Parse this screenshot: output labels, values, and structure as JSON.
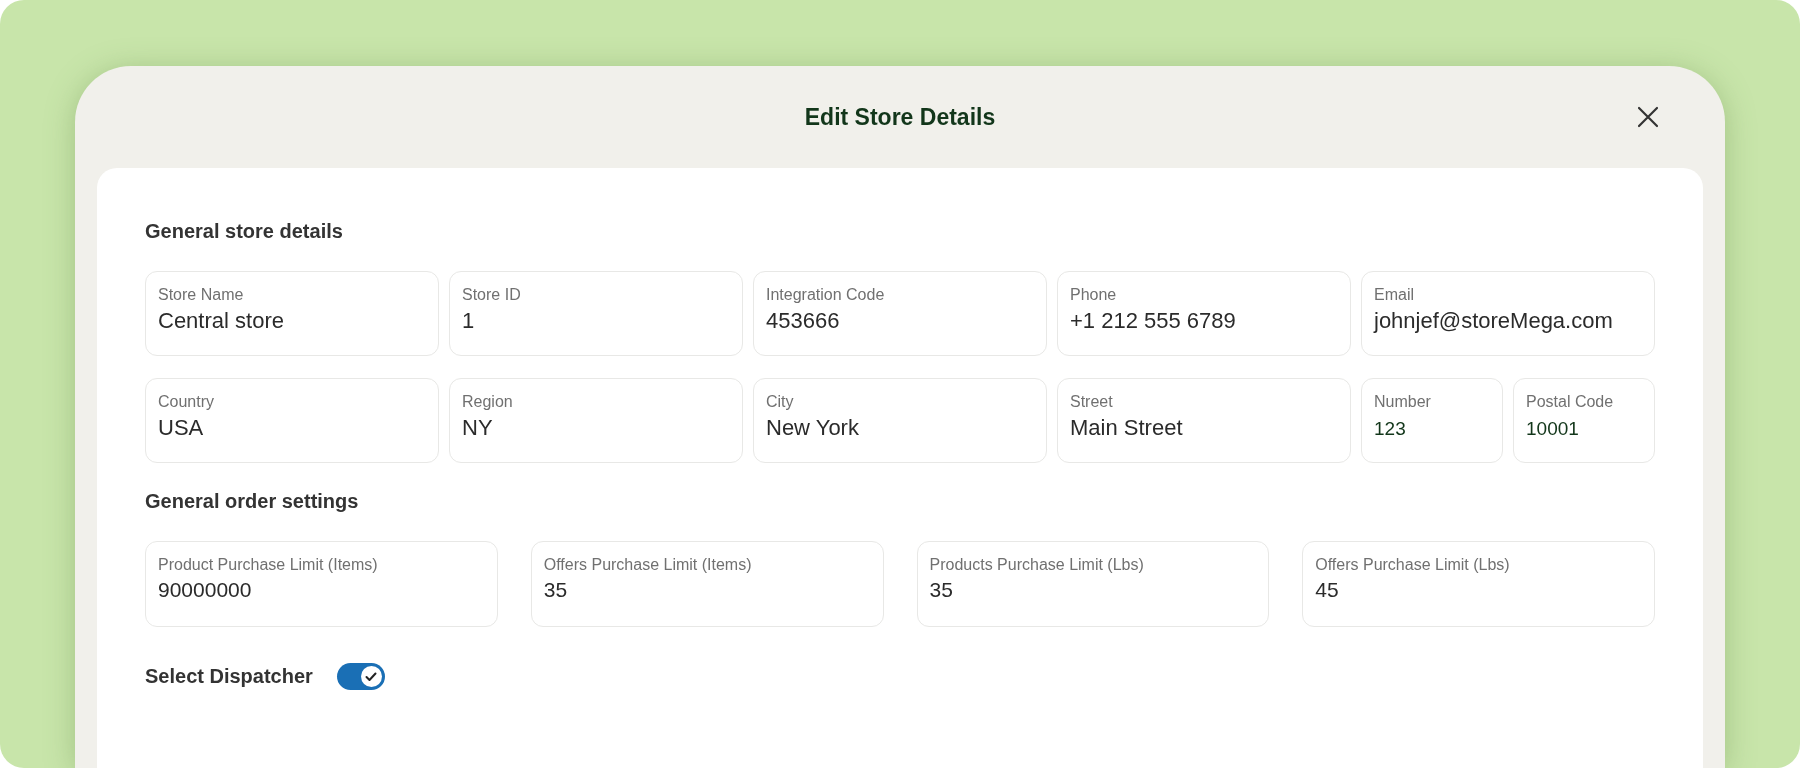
{
  "dialog": {
    "title": "Edit Store Details"
  },
  "sections": [
    {
      "heading": "General store details",
      "rows": [
        [
          {
            "label": "Store Name",
            "value": "Central store",
            "kind": "wide"
          },
          {
            "label": "Store ID",
            "value": "1",
            "kind": "wide"
          },
          {
            "label": "Integration Code",
            "value": "453666",
            "kind": "wide"
          },
          {
            "label": "Phone",
            "value": "+1 212 555 6789",
            "kind": "wide"
          },
          {
            "label": "Email",
            "value": "johnjef@storeMega.com",
            "kind": "wide"
          }
        ],
        [
          {
            "label": "Country",
            "value": "USA",
            "kind": "wide"
          },
          {
            "label": "Region",
            "value": "NY",
            "kind": "wide"
          },
          {
            "label": "City",
            "value": "New York",
            "kind": "wide"
          },
          {
            "label": "Street",
            "value": "Main Street",
            "kind": "wide"
          },
          {
            "label": "Number",
            "value": "123",
            "kind": "narrow"
          },
          {
            "label": "Postal Code",
            "value": "10001",
            "kind": "narrow"
          }
        ]
      ]
    },
    {
      "heading": "General order settings",
      "rows": [
        [
          {
            "label": "Product Purchase Limit  (Items)",
            "value": "90000000",
            "kind": "wide"
          },
          {
            "label": "Offers Purchase Limit (Items)",
            "value": "35",
            "kind": "wide"
          },
          {
            "label": "Products Purchase Limit (Lbs)",
            "value": "35",
            "kind": "wide"
          },
          {
            "label": "Offers Purchase Limit (Lbs)",
            "value": "45",
            "kind": "wide"
          }
        ]
      ]
    }
  ],
  "dispatcher": {
    "label": "Select Dispatcher",
    "on": true
  }
}
